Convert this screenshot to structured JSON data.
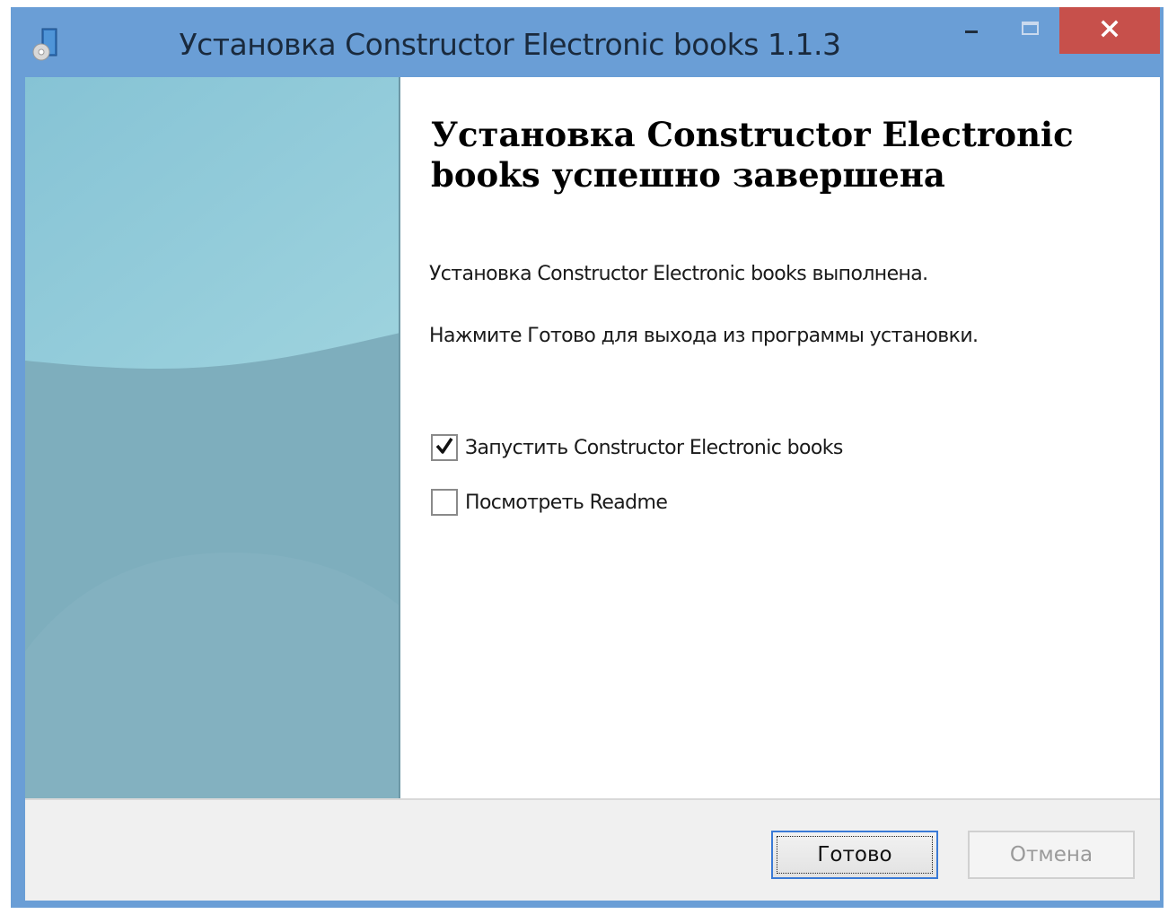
{
  "window": {
    "title": "Установка Constructor Electronic books 1.1.3",
    "app_icon": "installer-icon",
    "controls": {
      "minimize_icon": "minimize-icon",
      "maximize_icon": "maximize-icon",
      "close_icon": "close-icon"
    },
    "frame_color": "#6a9ed6",
    "close_color": "#c7504b"
  },
  "main": {
    "heading": "Установка Constructor Electronic books успешно завершена",
    "paragraphs": [
      "Установка Constructor Electronic books выполнена.",
      "Нажмите Готово для выхода из программы установки."
    ],
    "options": [
      {
        "label": "Запустить Constructor Electronic books",
        "checked": true
      },
      {
        "label": "Посмотреть Readme",
        "checked": false
      }
    ]
  },
  "footer": {
    "finish_label": "Готово",
    "cancel_label": "Отмена"
  },
  "colors": {
    "side_panel_light": "#8ec9d8",
    "side_panel_dark": "#7bacbb"
  }
}
